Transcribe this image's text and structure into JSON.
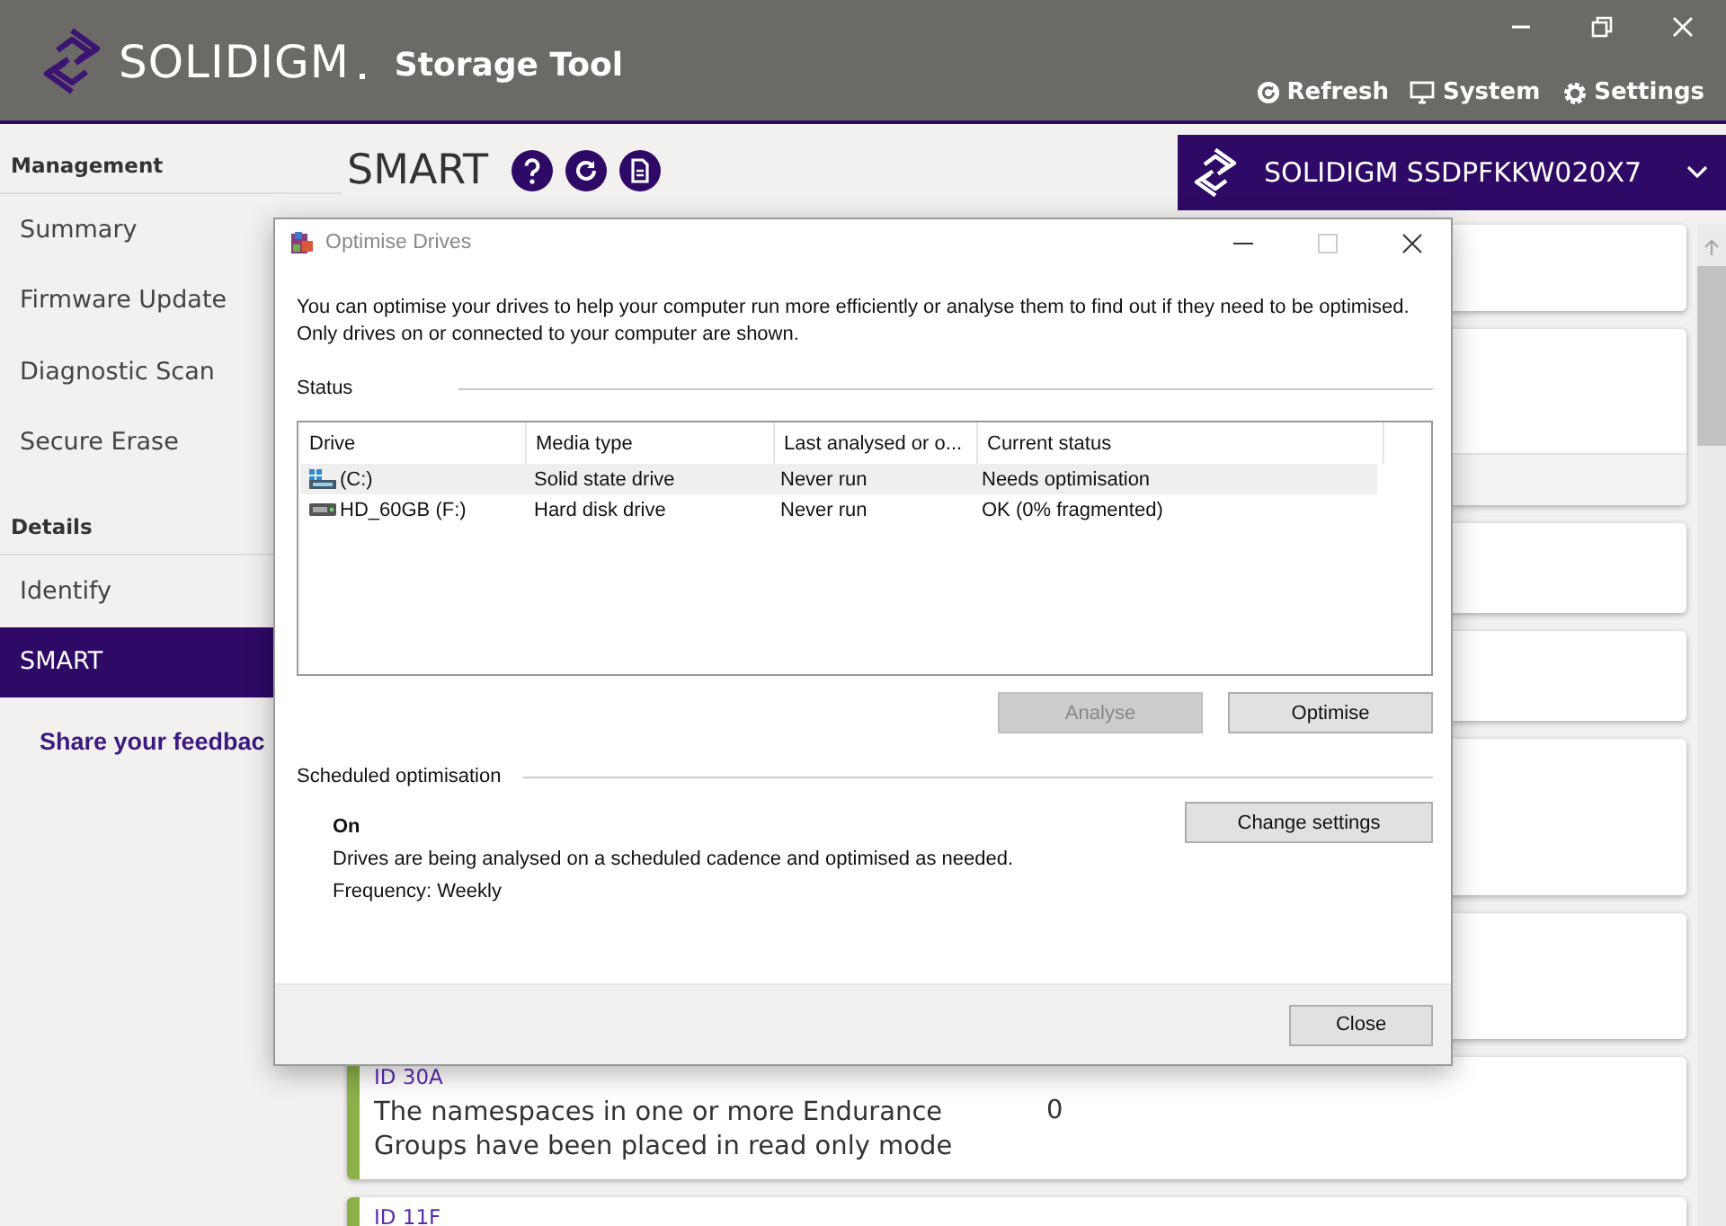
{
  "app": {
    "brand": "SOLIDIGM",
    "title": "Storage Tool",
    "actions": [
      {
        "label": "Refresh",
        "kind": "refresh"
      },
      {
        "label": "System",
        "kind": "system"
      },
      {
        "label": "Settings",
        "kind": "settings"
      }
    ]
  },
  "sidebar": {
    "sections": [
      {
        "heading": "Management",
        "items": [
          {
            "label": "Summary",
            "selected": false
          },
          {
            "label": "Firmware Update",
            "selected": false
          },
          {
            "label": "Diagnostic Scan",
            "selected": false
          },
          {
            "label": "Secure Erase",
            "selected": false
          }
        ]
      },
      {
        "heading": "Details",
        "items": [
          {
            "label": "Identify",
            "selected": false
          },
          {
            "label": "SMART",
            "selected": true
          }
        ]
      }
    ],
    "feedback_link": "Share your feedbac"
  },
  "page": {
    "title": "SMART",
    "device": "SOLIDIGM SSDPFKKW020X7",
    "cards": [
      {
        "id": "ID 30A",
        "description": "The namespaces in one or more Endurance Groups have been placed in read only mode",
        "value": "0"
      },
      {
        "id": "ID 11F"
      }
    ]
  },
  "dialog": {
    "title": "Optimise Drives",
    "intro": "You can optimise your drives to help your computer run more efficiently or analyse them to find out if they need to be optimised. Only drives on or connected to your computer are shown.",
    "status_heading": "Status",
    "table": {
      "columns": [
        "Drive",
        "Media type",
        "Last analysed or o...",
        "Current status"
      ],
      "rows": [
        {
          "kind": "ssd",
          "selected": true,
          "cells": [
            "(C:)",
            "Solid state drive",
            "Never run",
            "Needs optimisation"
          ]
        },
        {
          "kind": "hdd",
          "selected": false,
          "cells": [
            "HD_60GB (F:)",
            "Hard disk drive",
            "Never run",
            "OK (0% fragmented)"
          ]
        }
      ]
    },
    "buttons": [
      {
        "label": "Analyse",
        "disabled": true
      },
      {
        "label": "Optimise",
        "disabled": false
      }
    ],
    "schedule": {
      "heading": "Scheduled optimisation",
      "state": "On",
      "description": "Drives are being analysed on a scheduled cadence and optimised as needed.",
      "frequency": "Frequency: Weekly",
      "button": "Change settings"
    },
    "close_button": "Close"
  }
}
